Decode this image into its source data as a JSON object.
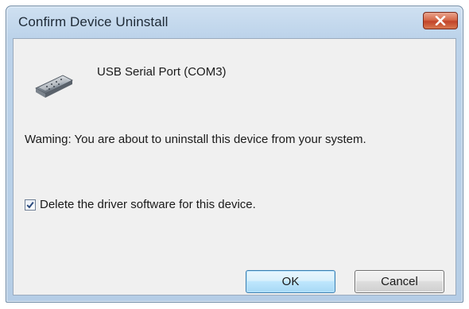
{
  "dialog": {
    "title": "Confirm Device Uninstall",
    "device_name": "USB Serial Port (COM3)",
    "warning": "Waming: You are about to uninstall this device from your system.",
    "checkbox": {
      "label": "Delete the driver software for this device.",
      "checked": true
    },
    "buttons": {
      "ok": "OK",
      "cancel": "Cancel"
    },
    "icons": {
      "close": "close-icon",
      "device": "serial-port-icon",
      "check": "checkmark-icon"
    },
    "colors": {
      "titlebar": "#bcd3ea",
      "client": "#f0f0f0",
      "close_button": "#c2442a",
      "ok_border": "#3c7fb1"
    }
  }
}
